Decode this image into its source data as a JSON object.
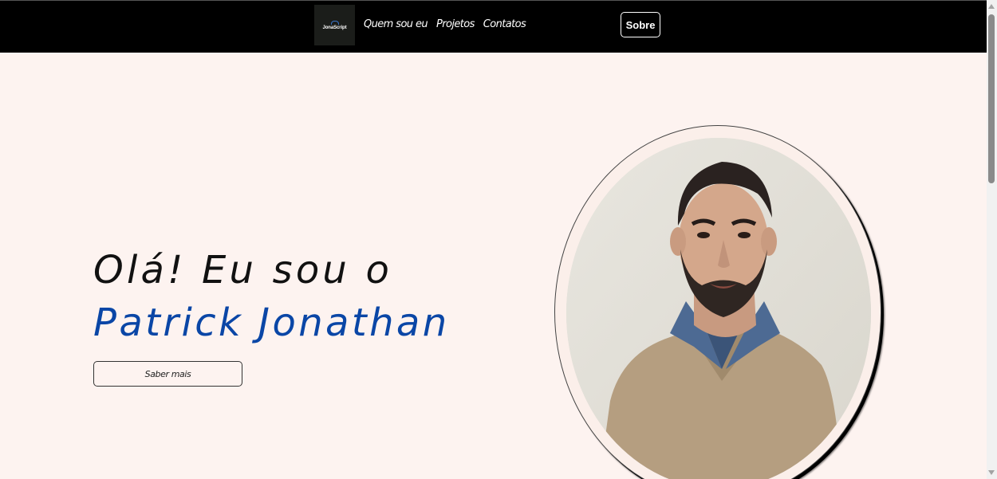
{
  "header": {
    "logo_text": "JonaScript",
    "nav": [
      {
        "label": "Quem sou eu"
      },
      {
        "label": "Projetos"
      },
      {
        "label": "Contatos"
      }
    ],
    "sobre_label": "Sobre"
  },
  "hero": {
    "greeting": "Olá! Eu sou o",
    "name": "Patrick Jonathan",
    "cta_label": "Saber mais"
  },
  "colors": {
    "background": "#fdf3f0",
    "topbar": "#000000",
    "accent_name": "#0a46a6"
  },
  "icons": {
    "logo": "code-logo-icon",
    "scroll_up": "scroll-up-arrow-icon",
    "scroll_down": "scroll-down-arrow-icon"
  }
}
